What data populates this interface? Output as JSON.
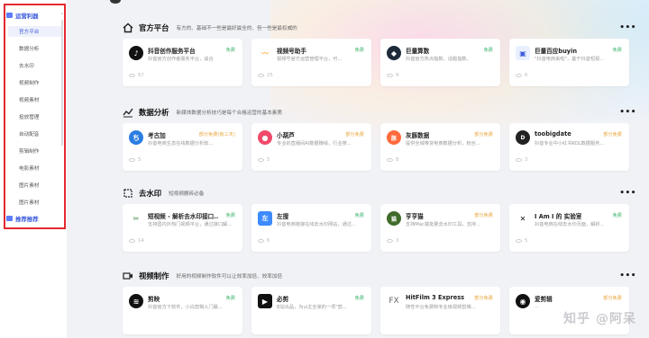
{
  "sidebar": {
    "group1": "运营利器",
    "items": [
      "官方平台",
      "数据分析",
      "去水印",
      "视频制作",
      "视频素材",
      "投放管理",
      "自动配音",
      "剪辑制作",
      "电影素材",
      "图片素材",
      "图片素材"
    ],
    "group2": "推荐推荐"
  },
  "sections": [
    {
      "title": "官方平台",
      "desc": "有方的、基础不一些是最好最全的、但一些是最权威的",
      "more": "•••",
      "cards": [
        {
          "name": "抖音创作服务平台",
          "price": "免费",
          "price_type": "free",
          "desc": "抖音官方创作者服务平台，适合",
          "views": "67",
          "logo_color": "#111111",
          "logo_glyph": "♪"
        },
        {
          "name": "视频号助手",
          "price": "免费",
          "price_type": "free",
          "desc": "视频号官方运营管理平台，可...",
          "views": "25",
          "logo_color": "#f5c542",
          "logo_glyph": "〰"
        },
        {
          "name": "巨量算数",
          "price": "免费",
          "price_type": "free",
          "desc": "抖音官方热点指数、话题指数、",
          "views": "9",
          "logo_color": "#1e2a3a",
          "logo_glyph": "◆"
        },
        {
          "name": "巨量百应buyin",
          "price": "免费",
          "price_type": "free",
          "desc": "\"抖音电商来啦\"，基于抖音短视...",
          "views": "6",
          "logo_color": "#e9f0ff",
          "logo_glyph": "▣"
        }
      ]
    },
    {
      "title": "数据分析",
      "desc": "新媒体数据分析技巧是每个合格运营的基本素质",
      "more": "•••",
      "cards": [
        {
          "name": "考古加",
          "price": "部分免费(有三天)",
          "price_type": "partial",
          "desc": "抖音电商生态在线数据分析软...",
          "views": "5",
          "logo_color": "#2a7de1",
          "logo_glyph": "ち"
        },
        {
          "name": "小葫芦",
          "price": "部分免费",
          "price_type": "partial",
          "desc": "专业的直播间AI数据赚钱，行业搜...",
          "views": "5",
          "logo_color": "#f04a6a",
          "logo_glyph": "●"
        },
        {
          "name": "灰豚数据",
          "price": "部分免费",
          "price_type": "partial",
          "desc": "提供全域带货电商数据分析，粉丝...",
          "views": "8",
          "logo_color": "#ff6a3d",
          "logo_glyph": "豚"
        },
        {
          "name": "toobigdate",
          "price": "部分免费",
          "price_type": "partial",
          "desc": "抖音专业中小红书KOL数据服务...",
          "views": "3",
          "logo_color": "#222222",
          "logo_glyph": "D"
        }
      ]
    },
    {
      "title": "去水印",
      "desc": "短视频搬砖必备",
      "more": "•••",
      "cards": [
        {
          "name": "短视频 - 解析去水印接口...",
          "price": "免费",
          "price_type": "free",
          "desc": "支持国内外热门视频平台，通过接口解...",
          "views": "14",
          "logo_color": "#ffffff",
          "logo_glyph": "✂"
        },
        {
          "name": "左搜",
          "price": "免费",
          "price_type": "free",
          "desc": "抖音电商链接在线去水印网站，通过...",
          "views": "6",
          "logo_color": "#3d8bff",
          "logo_glyph": "左"
        },
        {
          "name": "亨亨猫",
          "price": "部分免费",
          "price_type": "partial",
          "desc": "支持Mac端批量去水印工具，支持...",
          "views": "3",
          "logo_color": "#3f6b2a",
          "logo_glyph": "猫"
        },
        {
          "name": "I Am I 的 实验室",
          "price": "免费",
          "price_type": "free",
          "desc": "抖音电商在线去水印页面，解析...",
          "views": "5",
          "logo_color": "#ffffff",
          "logo_glyph": "✕"
        }
      ]
    },
    {
      "title": "视频制作",
      "desc": "好用的视频制作软件可以让效率加倍、效率加倍",
      "more": "•••",
      "cards": [
        {
          "name": "剪映",
          "price": "免费",
          "price_type": "free",
          "desc": "抖音官方下软件，小白剪辑入门最...",
          "views": "",
          "logo_color": "#111111",
          "logo_glyph": "≋"
        },
        {
          "name": "必剪",
          "price": "免费",
          "price_type": "free",
          "desc": "B站出品，为ui主全家的一项\"剪...",
          "views": "",
          "logo_color": "#111111",
          "logo_glyph": "▶"
        },
        {
          "name": "HitFilm 3 Express",
          "price": "部分免费",
          "price_type": "partial",
          "desc": "随性平台免费和专业级视频剪辑...",
          "views": "",
          "logo_color": "#ffffff",
          "logo_glyph": "FX"
        },
        {
          "name": "爱剪辑",
          "price": "部分免费",
          "price_type": "partial",
          "desc": "...",
          "views": "",
          "logo_color": "#111111",
          "logo_glyph": "◉"
        }
      ]
    }
  ],
  "watermark": "知乎 @阿呆"
}
